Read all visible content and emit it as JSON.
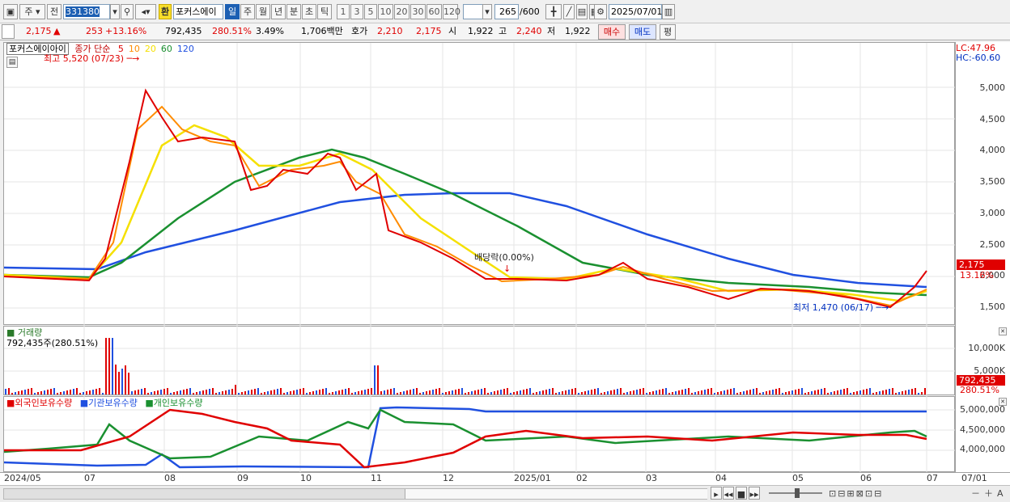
{
  "toolbar": {
    "market_label": "주",
    "type_label": "전",
    "code": "331380",
    "name_badge": "환",
    "name": "포커스에이",
    "periods": [
      "일",
      "주",
      "월",
      "년",
      "분",
      "초",
      "틱"
    ],
    "active_period": "일",
    "intervals": [
      "1",
      "3",
      "5",
      "10",
      "20",
      "30",
      "60",
      "120"
    ],
    "count": "265",
    "total": "/600",
    "date": "2025/07/01"
  },
  "quote": {
    "price": "2,175",
    "change_arrow": "▲",
    "change": "253",
    "change_pct": "+13.16%",
    "volume": "792,435",
    "volume_ratio": "280.51%",
    "turnover": "3.49%",
    "trade_amount": "1,706백만",
    "bid_label": "호가",
    "bid1": "2,210",
    "bid2": "2,175",
    "open_label": "시",
    "open": "1,922",
    "high_label": "고",
    "high": "2,240",
    "low_label": "저",
    "low": "1,922",
    "buy_label": "매수",
    "sell_label": "매도",
    "eval_label": "평"
  },
  "price_panel": {
    "title": "포커스에이아이",
    "ma_label": "종가 단순",
    "ma_periods": [
      "5",
      "10",
      "20",
      "60",
      "120"
    ],
    "ma_colors": [
      "#e00000",
      "#ff8c00",
      "#f5e000",
      "#1a9030",
      "#2050e0"
    ],
    "high_note": "최고 5,520 (07/23)",
    "low_note": "최저 1,470 (06/17)",
    "dividend_note": "배당락(0.00%)",
    "lc": "LC:47.96",
    "hc": "HC:-60.60",
    "price_tag": "2,175",
    "pct_tag": "13.16%",
    "yticks": [
      "5,000",
      "4,500",
      "4,000",
      "3,500",
      "3,000",
      "2,500",
      "2,000",
      "1,500"
    ]
  },
  "volume_panel": {
    "title": "거래량",
    "value": "792,435주(280.51%)",
    "yticks": [
      "10,000K",
      "5,000K"
    ],
    "tag": "792,435",
    "tag_pct": "280.51%"
  },
  "holder_panel": {
    "series": [
      "외국인보유수량",
      "기관보유수량",
      "개인보유수량"
    ],
    "yticks": [
      "5,000,000",
      "4,500,000",
      "4,000,000"
    ]
  },
  "xaxis": [
    "2024/05",
    "07",
    "08",
    "09",
    "10",
    "11",
    "12",
    "2025/01",
    "02",
    "03",
    "04",
    "05",
    "06",
    "07",
    "07/01"
  ]
}
